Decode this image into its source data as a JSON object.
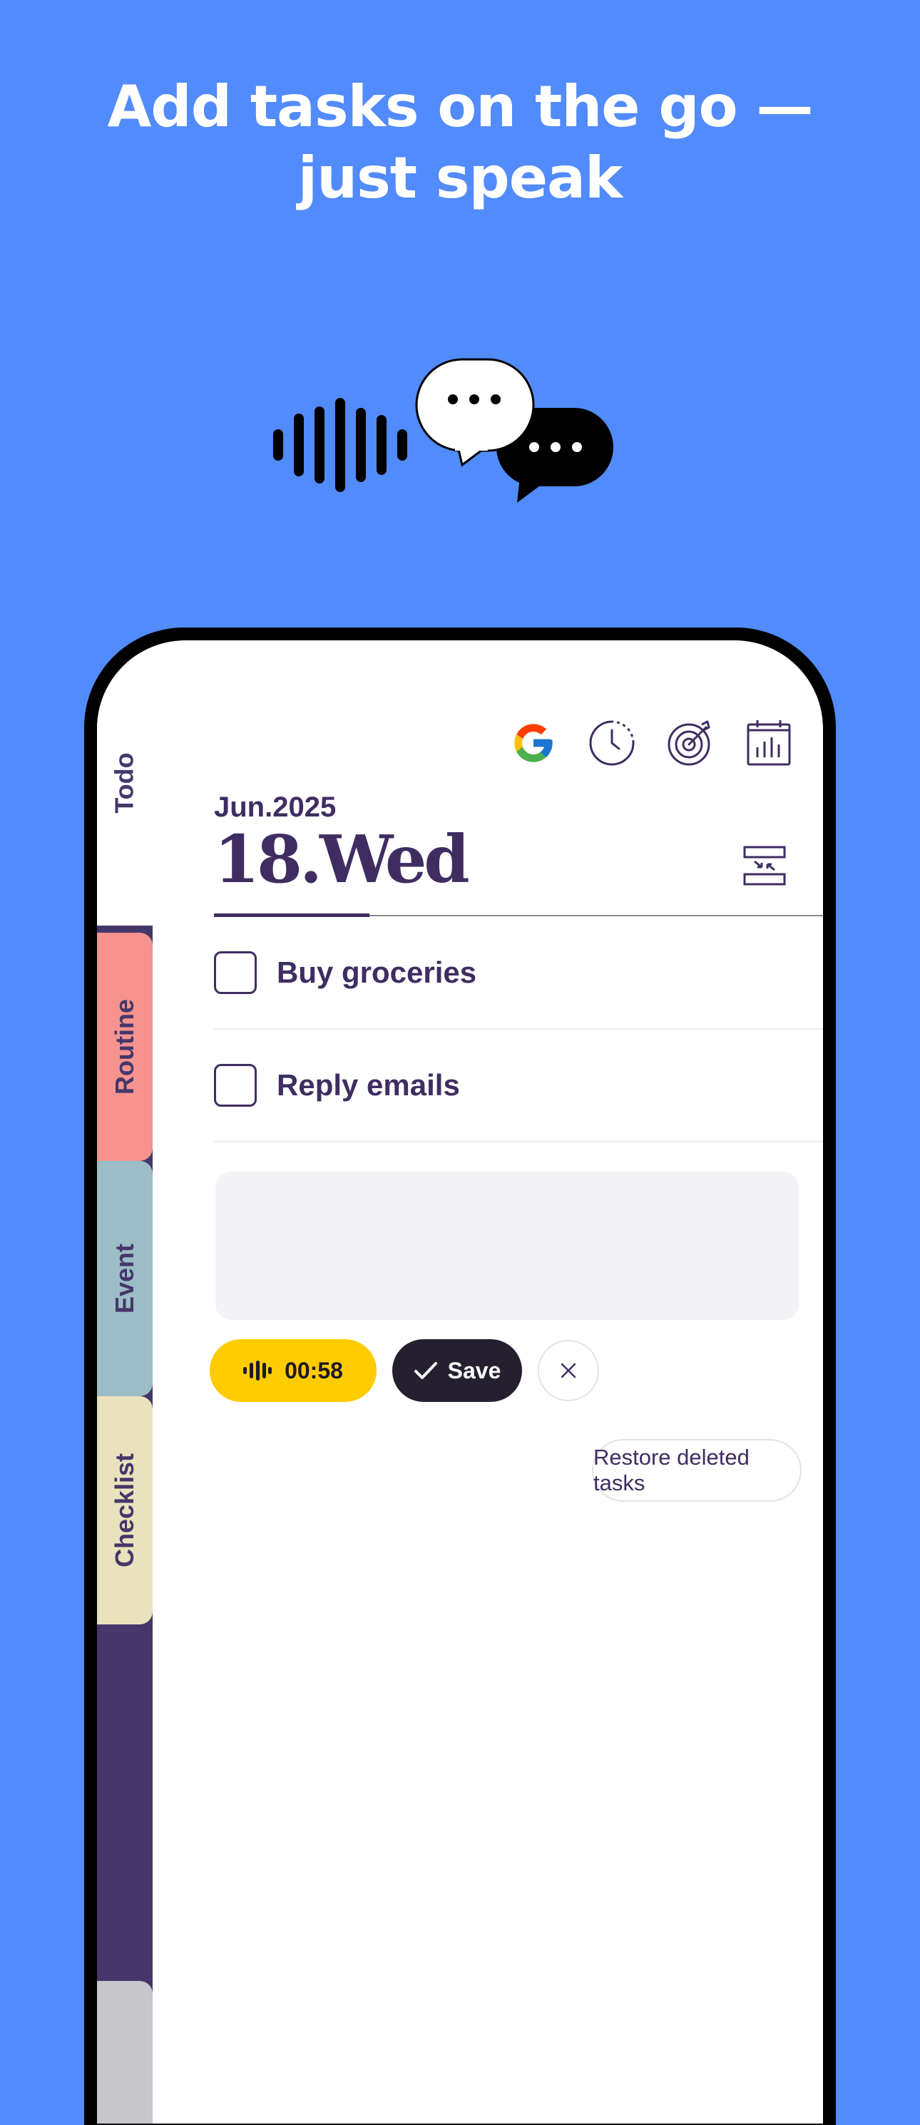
{
  "headline": {
    "line1": "Add tasks on the go —",
    "line2": "just speak"
  },
  "illustration": {
    "waveform_icon": "sound-wave-icon",
    "bubble_icons": [
      "speech-bubble-white-icon",
      "speech-bubble-black-icon"
    ]
  },
  "tabs": [
    {
      "label": "Todo",
      "color": "#ffffff"
    },
    {
      "label": "Routine",
      "color": "#f6938e"
    },
    {
      "label": "Event",
      "color": "#9cbdc6"
    },
    {
      "label": "Checklist",
      "color": "#e9e2bd"
    }
  ],
  "toolbar": {
    "icons": [
      "google-icon",
      "history-clock-icon",
      "target-icon",
      "calendar-stats-icon"
    ]
  },
  "date": {
    "month_year": "Jun.2025",
    "day": "18.Wed"
  },
  "tasks": [
    {
      "text": "Buy groceries",
      "checked": false
    },
    {
      "text": "Reply emails",
      "checked": false
    }
  ],
  "voice_input": {
    "record_time": "00:58",
    "save_label": "Save"
  },
  "restore_label": "Restore deleted tasks",
  "colors": {
    "background": "#528bfb",
    "primary_text": "#3f2d62",
    "record_yellow": "#fecc00",
    "save_dark": "#25202f",
    "tab_rail": "#453769"
  }
}
